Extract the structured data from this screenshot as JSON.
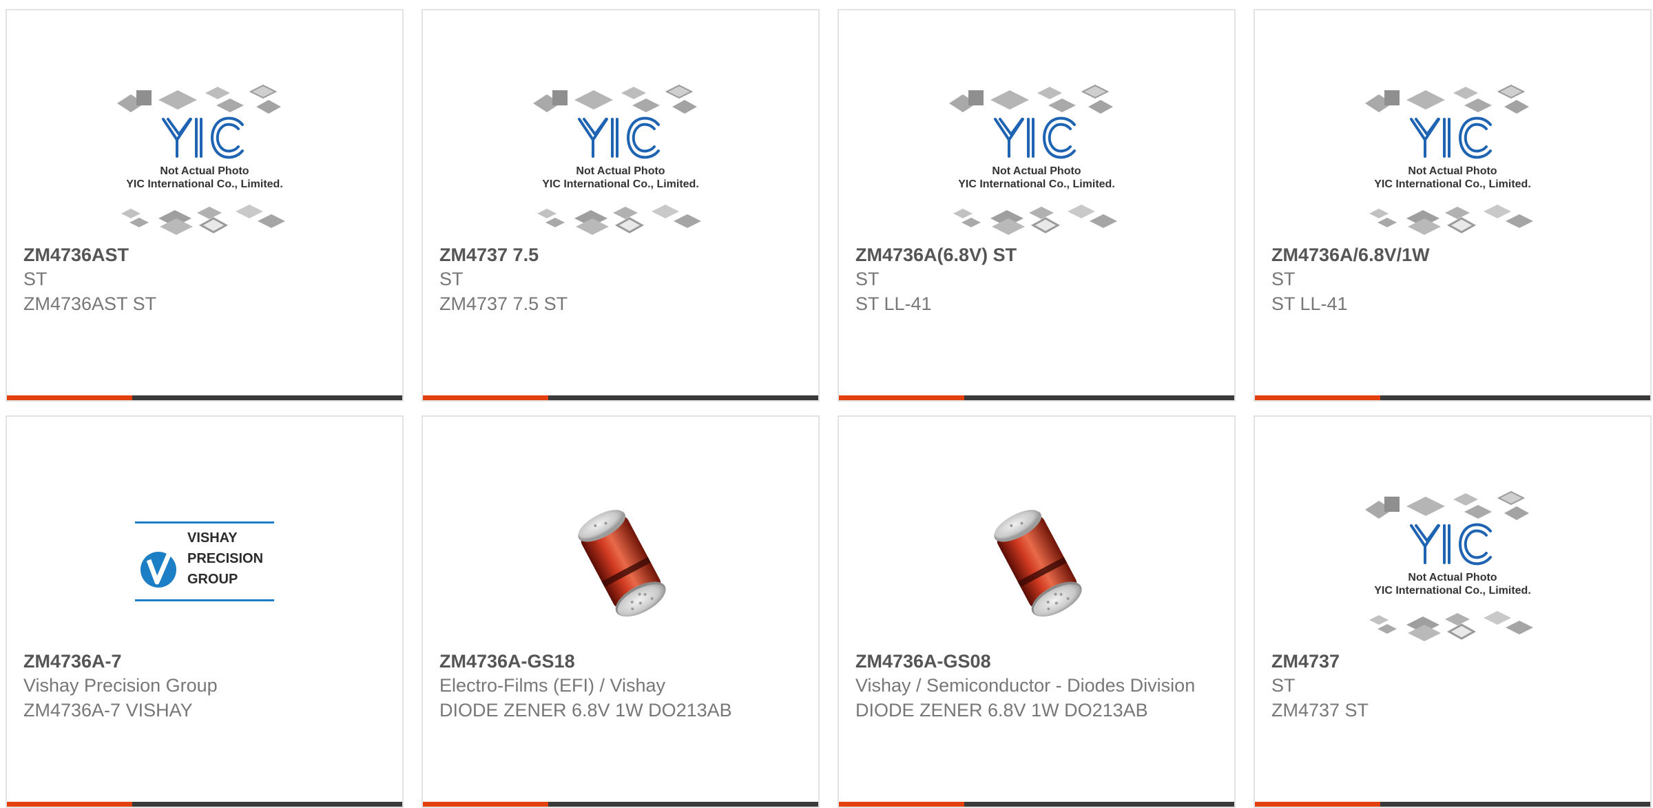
{
  "colors": {
    "accent": "#e4400e",
    "bar": "#3a3a3a",
    "card_border": "#e3e3e3",
    "title_text": "#555555",
    "body_text": "#777777"
  },
  "placeholder": {
    "brand": "YIC",
    "line1": "Not Actual Photo",
    "line2": "YIC International Co., Limited."
  },
  "products": [
    {
      "part": "ZM4736AST",
      "maker": "ST",
      "desc": "ZM4736AST ST",
      "image": "yic-placeholder-icon"
    },
    {
      "part": "ZM4737 7.5",
      "maker": "ST",
      "desc": "ZM4737 7.5 ST",
      "image": "yic-placeholder-icon"
    },
    {
      "part": "ZM4736A(6.8V) ST",
      "maker": "ST",
      "desc": "ST LL-41",
      "image": "yic-placeholder-icon"
    },
    {
      "part": "ZM4736A/6.8V/1W",
      "maker": "ST",
      "desc": "ST LL-41",
      "image": "yic-placeholder-icon"
    },
    {
      "part": "ZM4736A-7",
      "maker": "Vishay Precision Group",
      "desc": "ZM4736A-7 VISHAY",
      "image": "vishay-logo-icon",
      "logo": {
        "line1": "VISHAY",
        "line2": "PRECISION",
        "line3": "GROUP"
      }
    },
    {
      "part": "ZM4736A-GS18",
      "maker": "Electro-Films (EFI) / Vishay",
      "desc": "DIODE ZENER 6.8V 1W DO213AB",
      "image": "diode-photo-icon"
    },
    {
      "part": "ZM4736A-GS08",
      "maker": "Vishay / Semiconductor - Diodes Division",
      "desc": "DIODE ZENER 6.8V 1W DO213AB",
      "image": "diode-photo-icon"
    },
    {
      "part": "ZM4737",
      "maker": "ST",
      "desc": "ZM4737 ST",
      "image": "yic-placeholder-icon"
    }
  ]
}
